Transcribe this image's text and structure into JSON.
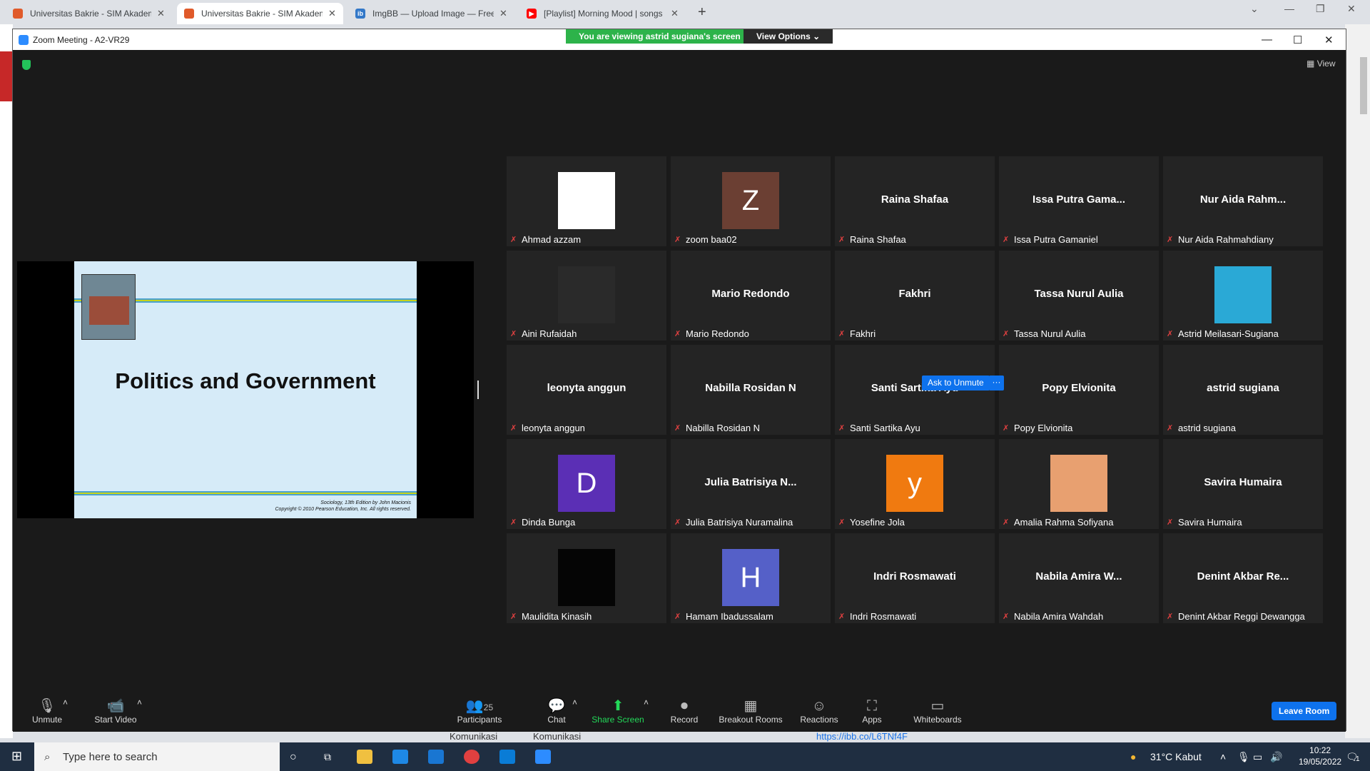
{
  "browser": {
    "tabs": [
      {
        "title": "Universitas Bakrie - SIM Akademik",
        "color": "#e05a2a"
      },
      {
        "title": "Universitas Bakrie - SIM Akademik",
        "color": "#e05a2a"
      },
      {
        "title": "ImgBB — Upload Image — Free Image Hosting",
        "color": "#3378c8"
      },
      {
        "title": "[Playlist] Morning Mood | songs to start",
        "color": "#ff0000"
      }
    ]
  },
  "zoom": {
    "title": "Zoom Meeting - A2-VR29",
    "viewing": "You are viewing astrid sugiana's screen",
    "view_options": "View Options",
    "view": "View"
  },
  "slide": {
    "title": "Politics and Government",
    "credit1": "Sociology, 13th Edition by John Macionis",
    "credit2": "Copyright © 2010 Pearson Education, Inc.  All rights reserved."
  },
  "participants": [
    {
      "name": "Ahmad azzam",
      "big": "",
      "avatar": "#ffffff",
      "letter": ""
    },
    {
      "name": "zoom baa02",
      "big": "",
      "avatar": "#6b3f33",
      "letter": "Z"
    },
    {
      "name": "Raina Shafaa",
      "big": "Raina Shafaa",
      "avatar": "",
      "letter": ""
    },
    {
      "name": "Issa Putra Gamaniel",
      "big": "Issa Putra Gama...",
      "avatar": "",
      "letter": ""
    },
    {
      "name": "Nur Aida Rahmahdiany",
      "big": "Nur Aida Rahm...",
      "avatar": "",
      "letter": ""
    },
    {
      "name": "Aini Rufaidah",
      "big": "",
      "avatar": "#2a2a2a",
      "letter": ""
    },
    {
      "name": "Mario Redondo",
      "big": "Mario Redondo",
      "avatar": "",
      "letter": ""
    },
    {
      "name": "Fakhri",
      "big": "Fakhri",
      "avatar": "",
      "letter": ""
    },
    {
      "name": "Tassa Nurul Aulia",
      "big": "Tassa Nurul Aulia",
      "avatar": "",
      "letter": ""
    },
    {
      "name": "Astrid Meilasari-Sugiana",
      "big": "",
      "avatar": "#2aa9d6",
      "letter": ""
    },
    {
      "name": "leonyta anggun",
      "big": "leonyta anggun",
      "avatar": "",
      "letter": ""
    },
    {
      "name": "Nabilla Rosidan N",
      "big": "Nabilla Rosidan N",
      "avatar": "",
      "letter": ""
    },
    {
      "name": "Santi Sartika Ayu",
      "big": "Santi Sartika Ayu",
      "avatar": "",
      "letter": ""
    },
    {
      "name": "Popy Elvionita",
      "big": "Popy Elvionita",
      "avatar": "",
      "letter": ""
    },
    {
      "name": "astrid sugiana",
      "big": "astrid sugiana",
      "avatar": "",
      "letter": ""
    },
    {
      "name": "Dinda Bunga",
      "big": "",
      "avatar": "#5b2fb5",
      "letter": "D"
    },
    {
      "name": "Julia Batrisiya Nuramalina",
      "big": "Julia Batrisiya N...",
      "avatar": "",
      "letter": ""
    },
    {
      "name": "Yosefine Jola",
      "big": "",
      "avatar": "#f07a10",
      "letter": "y"
    },
    {
      "name": "Amalia Rahma Sofiyana",
      "big": "",
      "avatar": "#e8a070",
      "letter": ""
    },
    {
      "name": "Savira Humaira",
      "big": "Savira Humaira",
      "avatar": "",
      "letter": ""
    },
    {
      "name": "Maulidita Kinasih",
      "big": "",
      "avatar": "#050505",
      "letter": ""
    },
    {
      "name": "Hamam Ibadussalam",
      "big": "",
      "avatar": "#5560c8",
      "letter": "H"
    },
    {
      "name": "Indri Rosmawati",
      "big": "Indri Rosmawati",
      "avatar": "",
      "letter": ""
    },
    {
      "name": "Nabila Amira Wahdah",
      "big": "Nabila Amira W...",
      "avatar": "",
      "letter": ""
    },
    {
      "name": "Denint Akbar Reggi Dewangga",
      "big": "Denint Akbar Re...",
      "avatar": "",
      "letter": ""
    }
  ],
  "ask_unmute": "Ask to Unmute",
  "toolbar": {
    "unmute": "Unmute",
    "start_video": "Start Video",
    "participants": "Participants",
    "participant_count": "25",
    "chat": "Chat",
    "share": "Share Screen",
    "record": "Record",
    "breakout": "Breakout Rooms",
    "reactions": "Reactions",
    "apps": "Apps",
    "whiteboards": "Whiteboards",
    "leave": "Leave Room"
  },
  "behind": {
    "k1": "Komunikasi",
    "k2": "Komunikasi",
    "link": "https://ibb.co/L6TNf4F"
  },
  "taskbar": {
    "search": "Type here to search",
    "weather": "31°C  Kabut",
    "time": "10:22",
    "date": "19/05/2022",
    "notif": "1"
  }
}
